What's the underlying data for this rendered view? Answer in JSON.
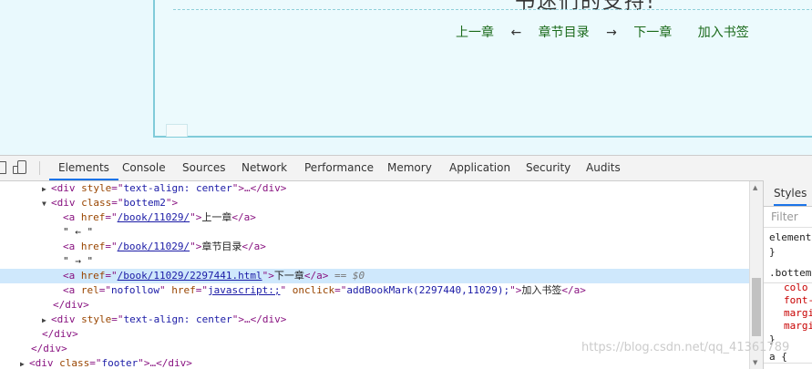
{
  "page": {
    "heading_fragment": "书迷们的支持!",
    "nav": {
      "prev": "上一章",
      "arrow_left": "←",
      "toc": "章节目录",
      "arrow_right": "→",
      "next": "下一章",
      "bookmark": "加入书签"
    }
  },
  "devtools": {
    "tabs": [
      "Elements",
      "Console",
      "Sources",
      "Network",
      "Performance",
      "Memory",
      "Application",
      "Security",
      "Audits"
    ],
    "active_tab": "Elements",
    "dom": {
      "r0": {
        "open": "<div ",
        "attr": "style",
        "eq": "=\"",
        "val": "text-align: center",
        "close": "\">…</div>"
      },
      "r1": {
        "open": "<div ",
        "attr": "class",
        "eq": "=\"",
        "val": "bottem2",
        "close": "\">"
      },
      "r2": {
        "open": "<a ",
        "attr": "href",
        "eq": "=\"",
        "val": "/book/11029/",
        "close": "\">",
        "text": "上一章",
        "end": "</a>"
      },
      "r3": {
        "text": "\" ← \""
      },
      "r4": {
        "open": "<a ",
        "attr": "href",
        "eq": "=\"",
        "val": "/book/11029/",
        "close": "\">",
        "text": "章节目录",
        "end": "</a>"
      },
      "r5": {
        "text": "\" → \""
      },
      "r6": {
        "open": "<a ",
        "attr": "href",
        "eq": "=\"",
        "val": "/book/11029/2297441.html",
        "close": "\">",
        "text": "下一章",
        "end": "</a>",
        "marker": " == $0"
      },
      "r7": {
        "open": "<a ",
        "attr1": "rel",
        "val1": "nofollow",
        "attr2": "href",
        "val2": "javascript:;",
        "attr3": "onclick",
        "val3": "addBookMark(2297440,11029);",
        "close": "\">",
        "text": "加入书签",
        "end": "</a>"
      },
      "r8": {
        "end": "</div>"
      },
      "r9": {
        "open": "<div ",
        "attr": "style",
        "eq": "=\"",
        "val": "text-align: center",
        "close": "\">…</div>"
      },
      "r10": {
        "end": "</div>"
      },
      "r11": {
        "end": "</div>"
      },
      "r12": {
        "open": "<div ",
        "attr": "class",
        "eq": "=\"",
        "val": "footer",
        "close": "\">…</div>"
      }
    },
    "styles": {
      "tab": "Styles",
      "filter_placeholder": "Filter",
      "element_line": "element",
      "brace_close": "}",
      "selector": ".bottem",
      "props": [
        "colo",
        "font-",
        "margi",
        "margi"
      ],
      "brace_close2": "}",
      "a_rule": "a {"
    }
  },
  "watermark": "https://blog.csdn.net/qq_41361789"
}
